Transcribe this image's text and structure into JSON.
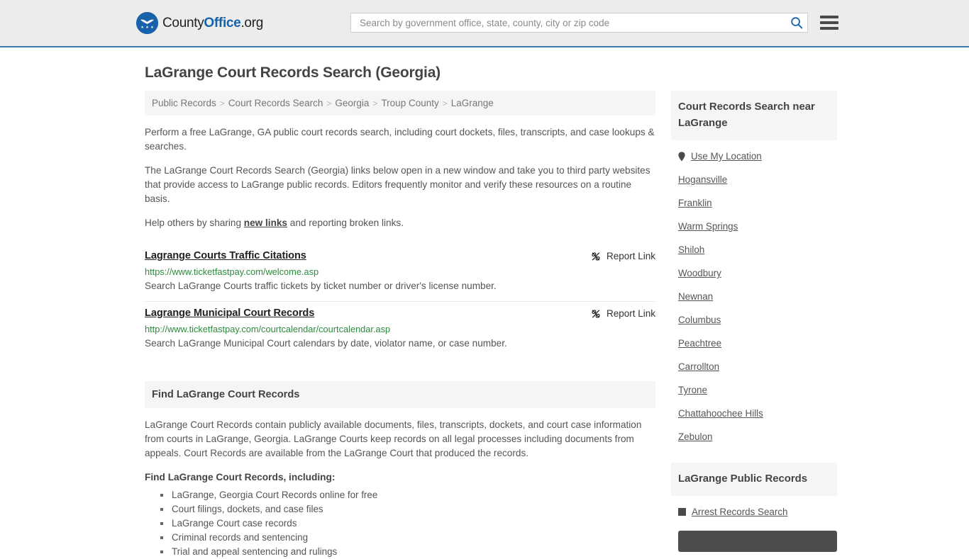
{
  "header": {
    "logo": {
      "icon": "eagle-shield-logo-icon",
      "part1": "County",
      "part2": "Office",
      "part3": ".org"
    },
    "search": {
      "placeholder": "Search by government office, state, county, city or zip code",
      "value": "",
      "icon": "search-icon"
    },
    "menu_icon": "hamburger-menu-icon",
    "accent_color": "#1862ab",
    "border_color": "#3b78ab",
    "background_color": "#ececea"
  },
  "page": {
    "title": "LaGrange Court Records Search (Georgia)"
  },
  "breadcrumb": {
    "items": [
      "Public Records",
      "Court Records Search",
      "Georgia",
      "Troup County",
      "LaGrange"
    ],
    "separator": ">"
  },
  "intro": {
    "paragraph1": "Perform a free LaGrange, GA public court records search, including court dockets, files, transcripts, and case lookups & searches.",
    "paragraph2": "The LaGrange Court Records Search (Georgia) links below open in a new window and take you to third party websites that provide access to LaGrange public records. Editors frequently monitor and verify these resources on a routine basis.",
    "paragraph3_before": "Help others by sharing ",
    "paragraph3_link": "new links",
    "paragraph3_after": " and reporting broken links."
  },
  "links": [
    {
      "title": "Lagrange Courts Traffic Citations",
      "url": "https://www.ticketfastpay.com/welcome.asp",
      "description": "Search LaGrange Courts traffic tickets by ticket number or driver's license number.",
      "report_label": "Report Link",
      "report_icon": "broken-link-icon"
    },
    {
      "title": "Lagrange Municipal Court Records",
      "url": "http://www.ticketfastpay.com/courtcalendar/courtcalendar.asp",
      "description": "Search LaGrange Municipal Court calendars by date, violator name, or case number.",
      "report_label": "Report Link",
      "report_icon": "broken-link-icon"
    }
  ],
  "find_section": {
    "heading": "Find LaGrange Court Records",
    "body": "LaGrange Court Records contain publicly available documents, files, transcripts, dockets, and court case information from courts in LaGrange, Georgia. LaGrange Courts keep records on all legal processes including documents from appeals. Court Records are available from the LaGrange Court that produced the records.",
    "sub_heading": "Find LaGrange Court Records, including:",
    "bullets": [
      "LaGrange, Georgia Court Records online for free",
      "Court filings, dockets, and case files",
      "LaGrange Court case records",
      "Criminal records and sentencing",
      "Trial and appeal sentencing and rulings"
    ]
  },
  "sidebar": {
    "nearby": {
      "heading": "Court Records Search near LaGrange",
      "use_my_location": {
        "label": "Use My Location",
        "icon": "map-pin-icon"
      },
      "cities": [
        "Hogansville",
        "Franklin",
        "Warm Springs",
        "Shiloh",
        "Woodbury",
        "Newnan",
        "Columbus",
        "Peachtree",
        "Carrollton",
        "Tyrone",
        "Chattahoochee Hills",
        "Zebulon"
      ]
    },
    "public_records": {
      "heading": "LaGrange Public Records",
      "items": [
        {
          "label": "Arrest Records Search",
          "icon": "square-bullet-icon"
        }
      ]
    }
  }
}
